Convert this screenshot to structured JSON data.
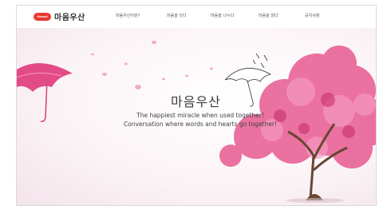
{
  "brand": {
    "logo_badge": "Hansol",
    "logo_text": "마음우산"
  },
  "nav": {
    "items": [
      {
        "label": "마음우산이란?"
      },
      {
        "label": "마음을 잇다"
      },
      {
        "label": "마음을 나누다"
      },
      {
        "label": "마음을 읽다"
      },
      {
        "label": "공지사항"
      }
    ]
  },
  "hero": {
    "title": "마음우산",
    "subtitle_line1": "The happiest miracle when used together!",
    "subtitle_line2": "Conversation where words and hearts go together!"
  },
  "colors": {
    "accent": "#e83a2e",
    "blossom": "#e6508a",
    "trunk": "#6a4632"
  }
}
